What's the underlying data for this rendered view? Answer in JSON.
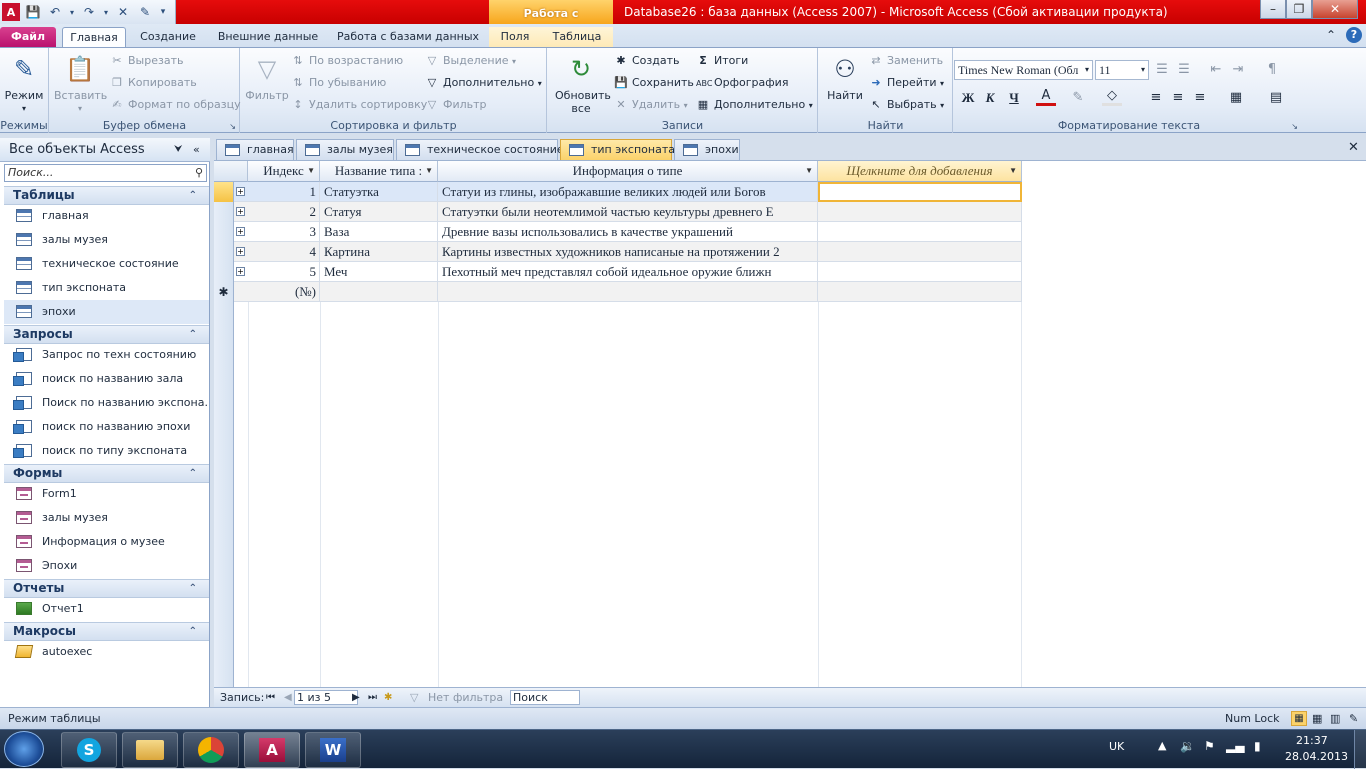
{
  "window": {
    "context_tab_header": "Работа с таблицами",
    "title": "Database26 : база данных (Access 2007)  -  Microsoft Access (Сбой активации продукта)"
  },
  "ribbon_tabs": [
    "Файл",
    "Главная",
    "Создание",
    "Внешние данные",
    "Работа с базами данных",
    "Поля",
    "Таблица"
  ],
  "ribbon": {
    "views": {
      "mode_label": "Режим",
      "group": "Режимы"
    },
    "clipboard": {
      "paste": "Вставить",
      "cut": "Вырезать",
      "copy": "Копировать",
      "format_painter": "Формат по образцу",
      "group": "Буфер обмена"
    },
    "sort_filter": {
      "filter": "Фильтр",
      "ascending": "По возрастанию",
      "descending": "По убыванию",
      "remove_sort": "Удалить сортировку",
      "selection": "Выделение",
      "advanced": "Дополнительно",
      "toggle_filter": "Фильтр",
      "group": "Сортировка и фильтр"
    },
    "records": {
      "refresh": "Обновить все",
      "new": "Создать",
      "save": "Сохранить",
      "delete": "Удалить",
      "totals": "Итоги",
      "spelling": "Орфография",
      "more": "Дополнительно",
      "group": "Записи"
    },
    "find": {
      "find": "Найти",
      "replace": "Заменить",
      "goto": "Перейти",
      "select": "Выбрать",
      "group": "Найти"
    },
    "text_format": {
      "font": "Times New Roman (Обл",
      "size": "11",
      "bold": "Ж",
      "italic": "К",
      "underline": "Ч",
      "group": "Форматирование текста"
    }
  },
  "nav": {
    "header": "Все объекты Access",
    "search_placeholder": "Поиск...",
    "sections": [
      {
        "title": "Таблицы",
        "items": [
          "главная",
          "залы музея",
          "техническое состояние",
          "тип экспоната",
          "эпохи"
        ]
      },
      {
        "title": "Запросы",
        "items": [
          "Запрос по техн состоянию",
          "поиск по названию зала",
          "Поиск по названию экспона...",
          "поиск по названию эпохи",
          "поиск по типу экспоната"
        ]
      },
      {
        "title": "Формы",
        "items": [
          "Form1",
          "залы музея",
          "Информация о музее",
          "Эпохи"
        ]
      },
      {
        "title": "Отчеты",
        "items": [
          "Отчет1"
        ]
      },
      {
        "title": "Макросы",
        "items": [
          "autoexec"
        ]
      }
    ]
  },
  "object_tabs": [
    "главная",
    "залы музея",
    "техническое состояние",
    "тип экспоната",
    "эпохи"
  ],
  "grid": {
    "columns": [
      "Индекс",
      "Название типа :",
      "Информация о типе",
      "Щелкните для добавления"
    ],
    "rows": [
      {
        "id": "1",
        "name": "Статуэтка",
        "info": "Статуи из глины, изображавшие великих людей или Богов"
      },
      {
        "id": "2",
        "name": "Статуя",
        "info": "Статуэтки были неотемлимой частью кеультуры древнего Е"
      },
      {
        "id": "3",
        "name": "Ваза",
        "info": "Древние вазы использовались в качестве украшений"
      },
      {
        "id": "4",
        "name": "Картина",
        "info": "Картины известных художников написаные на протяжении 2"
      },
      {
        "id": "5",
        "name": "Меч",
        "info": "Пехотный  меч представлял собой идеальное оружие ближн"
      }
    ],
    "new_row_marker": "(№)"
  },
  "record_nav": {
    "label": "Запись:",
    "position": "1 из 5",
    "filter": "Нет фильтра",
    "search": "Поиск"
  },
  "status": {
    "mode": "Режим таблицы",
    "numlock": "Num Lock"
  },
  "taskbar": {
    "lang": "UK",
    "time": "21:37",
    "date": "28.04.2013"
  },
  "colors": {
    "title_bar": "#e60c0c",
    "file_tab": "#c81277",
    "context_tab": "#f7a51c",
    "selected_row": "#dbe7f8",
    "active_tab": "#fbd26a"
  }
}
